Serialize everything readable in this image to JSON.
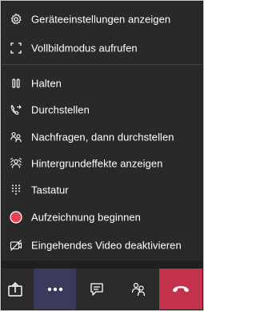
{
  "menu": {
    "items": [
      {
        "label": "Geräteeinstellungen anzeigen",
        "icon": "gear-icon"
      },
      {
        "label": "Vollbildmodus aufrufen",
        "icon": "fullscreen-icon"
      },
      {
        "label": "Halten",
        "icon": "pause-icon"
      },
      {
        "label": "Durchstellen",
        "icon": "call-transfer-icon"
      },
      {
        "label": "Nachfragen, dann durchstellen",
        "icon": "consult-transfer-icon"
      },
      {
        "label": "Hintergrundeffekte anzeigen",
        "icon": "background-effects-icon"
      },
      {
        "label": "Tastatur",
        "icon": "dialpad-icon"
      },
      {
        "label": "Aufzeichnung beginnen",
        "icon": "record-icon"
      },
      {
        "label": "Eingehendes Video deaktivieren",
        "icon": "video-off-icon"
      }
    ]
  },
  "toolbar": {
    "buttons": [
      {
        "icon": "share-icon"
      },
      {
        "icon": "more-icon"
      },
      {
        "icon": "chat-icon"
      },
      {
        "icon": "people-icon"
      },
      {
        "icon": "hang-up-icon"
      }
    ]
  },
  "colors": {
    "menu_bg": "#292929",
    "text": "#ffffff",
    "record_red": "#e8434f",
    "hangup_red": "#c4314b",
    "more_active_bg": "#3a3a5c",
    "toolbar_bg": "#2a2a2a"
  }
}
